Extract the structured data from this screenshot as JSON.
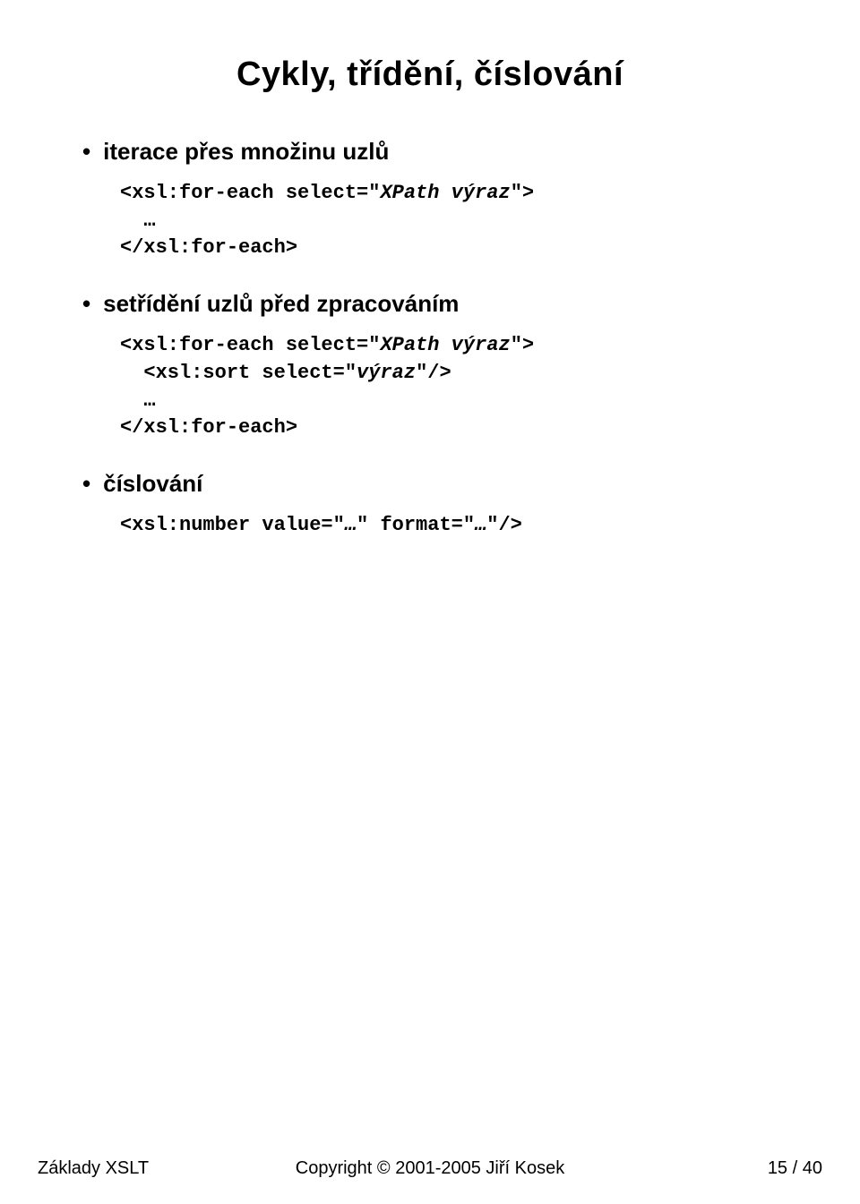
{
  "title": "Cykly, třídění, číslování",
  "sections": [
    {
      "bullet_label": "iterace přes množinu uzlů",
      "code_lines": [
        {
          "pre": "<xsl:for-each select=\"",
          "italic": "XPath výraz",
          "post": "\">",
          "indent": 0
        },
        {
          "pre": "  …",
          "italic": "",
          "post": "",
          "indent": 0
        },
        {
          "pre": "</xsl:for-each>",
          "italic": "",
          "post": "",
          "indent": 0
        }
      ]
    },
    {
      "bullet_label": "setřídění uzlů před zpracováním",
      "code_lines": [
        {
          "pre": "<xsl:for-each select=\"",
          "italic": "XPath výraz",
          "post": "\">",
          "indent": 0
        },
        {
          "pre": "  <xsl:sort select=\"",
          "italic": "výraz",
          "post": "\"/>",
          "indent": 0
        },
        {
          "pre": "  …",
          "italic": "",
          "post": "",
          "indent": 0
        },
        {
          "pre": "</xsl:for-each>",
          "italic": "",
          "post": "",
          "indent": 0
        }
      ]
    },
    {
      "bullet_label": "číslování",
      "code_lines": [
        {
          "pre": "<xsl:number value=\"",
          "italic": "…",
          "post": "\" format=\"",
          "italic2": "…",
          "post2": "\"/>",
          "indent": 0
        }
      ]
    }
  ],
  "footer": {
    "left": "Základy XSLT",
    "center": "Copyright © 2001-2005 Jiří Kosek",
    "right": "15 / 40"
  }
}
